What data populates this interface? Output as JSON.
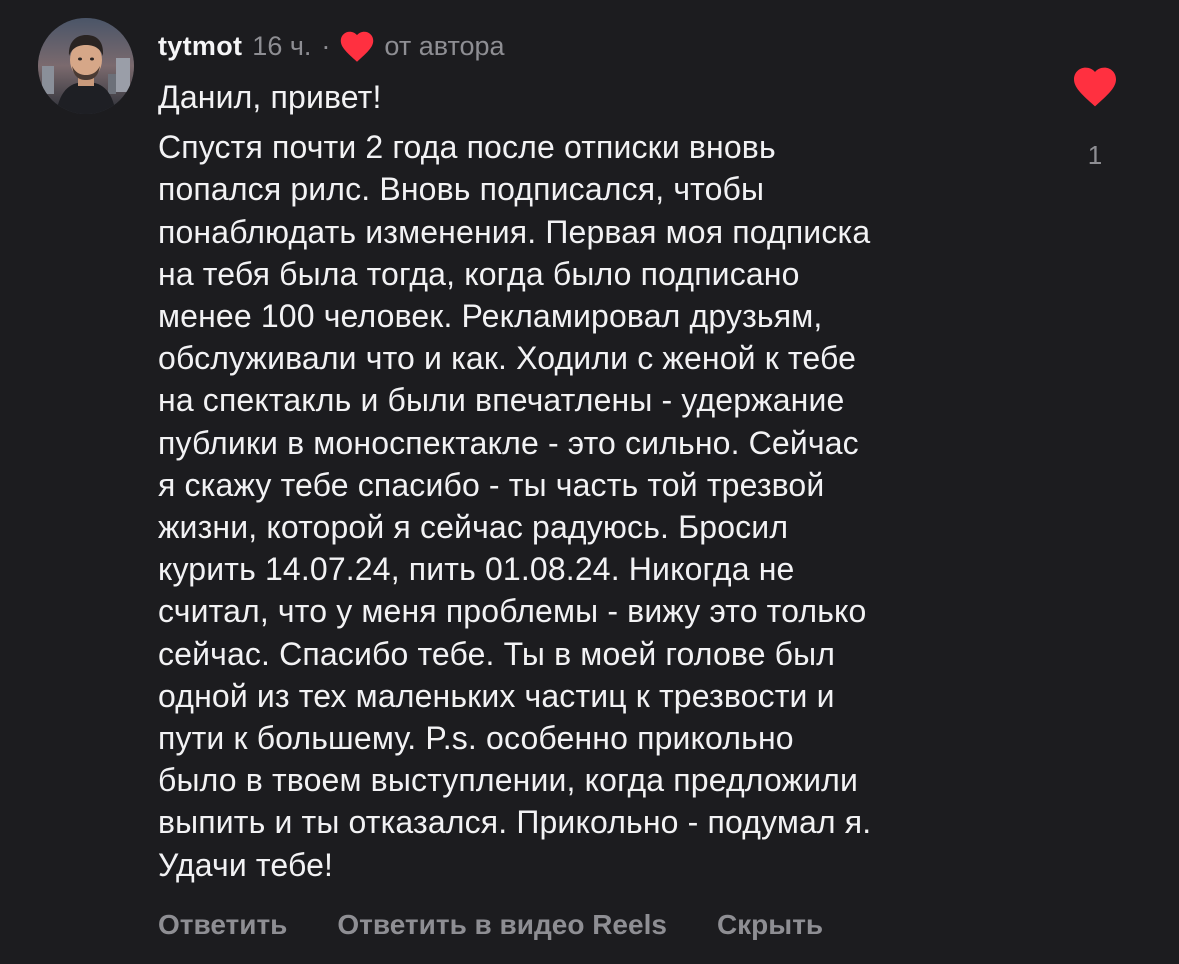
{
  "comment": {
    "username": "tytmot",
    "time": "16 ч.",
    "separator": "·",
    "author_like_label": "от автора",
    "greeting": "Данил, привет!",
    "body_lines": [
      "Спустя почти 2 года после отписки вновь",
      "попался рилс. Вновь подписался, чтобы",
      "понаблюдать изменения. Первая моя подписка",
      "на тебя была тогда, когда было подписано",
      "менее 100 человек. Рекламировал друзьям,",
      "обслуживали что и как. Ходили с женой к тебе",
      "на спектакль и были впечатлены - удержание",
      "публики в моноспектакле - это сильно. Сейчас",
      "я скажу тебе спасибо - ты часть той трезвой",
      "жизни, которой я сейчас радуюсь. Бросил",
      "курить 14.07.24, пить 01.08.24. Никогда не",
      "считал, что у меня проблемы - вижу это только",
      "сейчас. Спасибо тебе. Ты в моей голове был",
      "одной из тех маленьких частиц к трезвости и",
      "пути к большему. P.s. особенно прикольно",
      "было в твоем выступлении, когда предложили",
      "выпить и ты отказался. Прикольно - подумал я.",
      "Удачи тебе!"
    ],
    "like_count": "1",
    "liked": true,
    "heart_color": "#ff3040"
  },
  "actions": {
    "reply": "Ответить",
    "reply_reels": "Ответить в видео Reels",
    "hide": "Скрыть"
  },
  "icons": {
    "avatar": "avatar",
    "author_heart": "heart-icon",
    "like_heart": "heart-filled-icon"
  }
}
